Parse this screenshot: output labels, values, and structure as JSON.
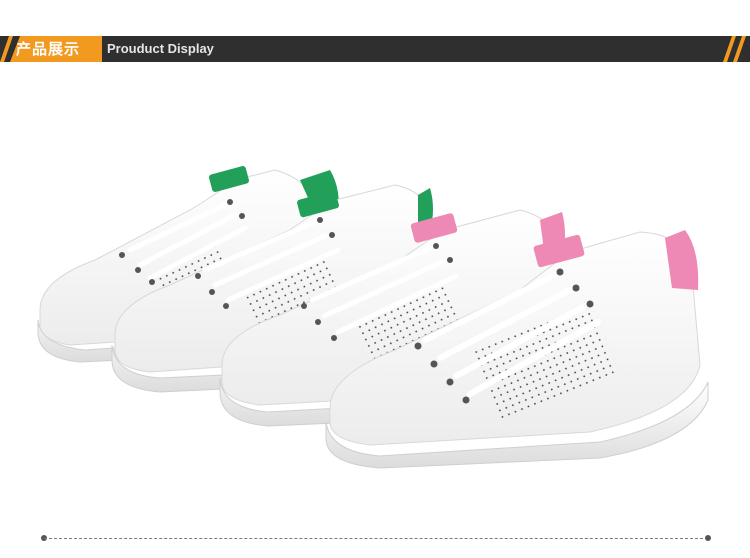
{
  "banner": {
    "title_cn": "产品展示",
    "title_en": "Prouduct Display"
  },
  "colors": {
    "banner_bg": "#2f2f2f",
    "tag_orange": "#f29a1f",
    "accent_green": "#22a05a",
    "accent_pink": "#ee88b4"
  },
  "icons": [
    "slash-left-icon",
    "slash-right-icon"
  ]
}
